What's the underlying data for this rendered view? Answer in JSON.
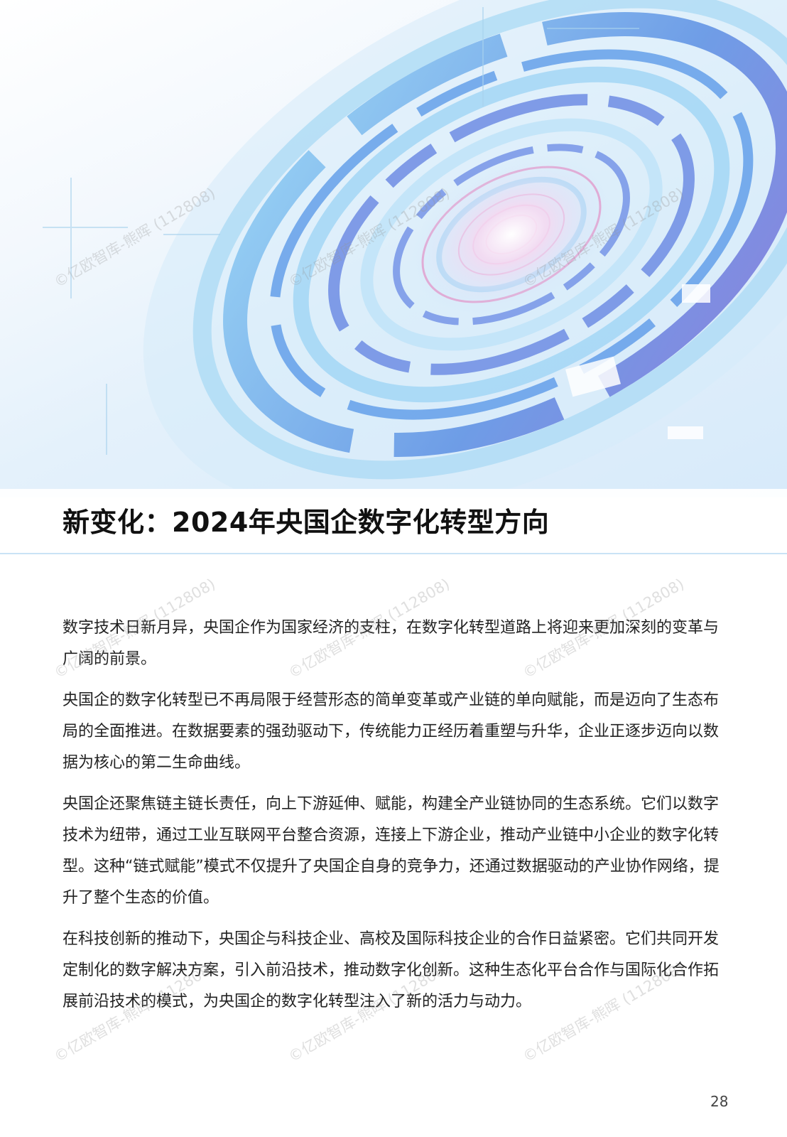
{
  "hero": {
    "image": "abstract-digital-circular-tech-illustration"
  },
  "title": "新变化：2024年央国企数字化转型方向",
  "paragraphs": [
    "数字技术日新月异，央国企作为国家经济的支柱，在数字化转型道路上将迎来更加深刻的变革与广阔的前景。",
    "央国企的数字化转型已不再局限于经营形态的简单变革或产业链的单向赋能，而是迈向了生态布局的全面推进。在数据要素的强劲驱动下，传统能力正经历着重塑与升华，企业正逐步迈向以数据为核心的第二生命曲线。",
    "央国企还聚焦链主链长责任，向上下游延伸、赋能，构建全产业链协同的生态系统。它们以数字技术为纽带，通过工业互联网平台整合资源，连接上下游企业，推动产业链中小企业的数字化转型。这种“链式赋能”模式不仅提升了央国企自身的竞争力，还通过数据驱动的产业协作网络，提升了整个生态的价值。",
    "在科技创新的推动下，央国企与科技企业、高校及国际科技企业的合作日益紧密。它们共同开发定制化的数字解决方案，引入前沿技术，推动数字化创新。这种生态化平台合作与国际化合作拓展前沿技术的模式，为央国企的数字化转型注入了新的活力与动力。"
  ],
  "page_number": "28",
  "watermark": "©亿欧智库-熊晖 (112808)",
  "colors": {
    "accent_blue": "#4a8ee6",
    "light_blue": "#9fd4f5",
    "pink": "#e48fc4"
  }
}
